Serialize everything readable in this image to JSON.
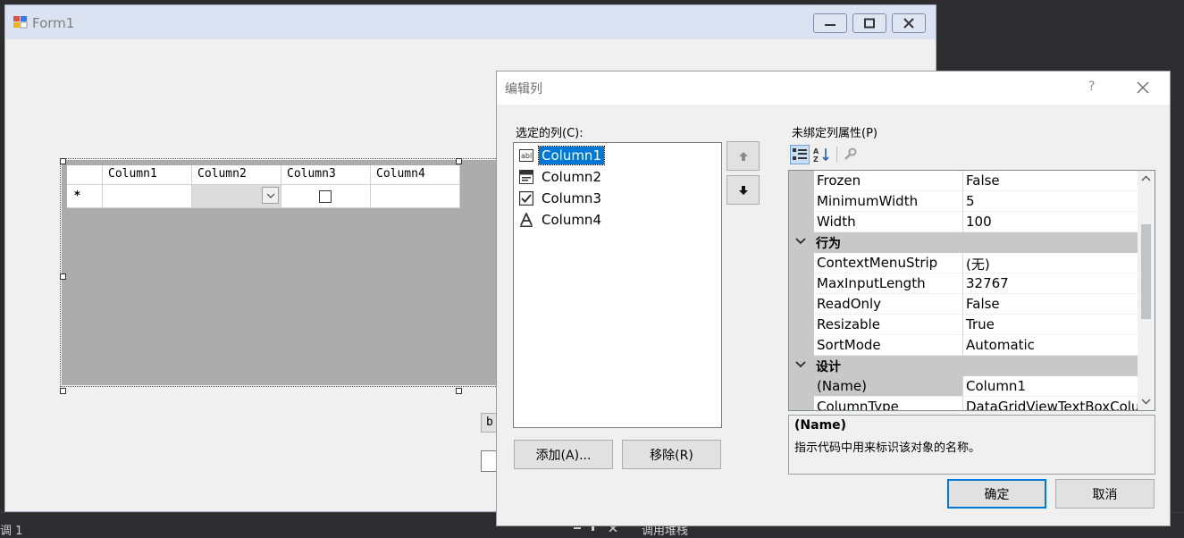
{
  "form1": {
    "title": "Form1",
    "grid": {
      "columns": [
        "Column1",
        "Column2",
        "Column3",
        "Column4"
      ],
      "new_row_marker": "*"
    },
    "partial_button_text": "b"
  },
  "bottom_bar": {
    "left_text": "调 1",
    "right_text": "调用堆栈"
  },
  "dialog": {
    "title": "编辑列",
    "help_glyph": "?",
    "selected_columns_label": "选定的列(C):",
    "columns": [
      {
        "name": "Column1",
        "icon": "textbox-column-icon",
        "selected": true
      },
      {
        "name": "Column2",
        "icon": "combobox-column-icon",
        "selected": false
      },
      {
        "name": "Column3",
        "icon": "checkbox-column-icon",
        "selected": false
      },
      {
        "name": "Column4",
        "icon": "text-a-column-icon",
        "selected": false
      }
    ],
    "add_button": "添加(A)...",
    "remove_button": "移除(R)",
    "properties_label": "未绑定列属性(P)",
    "properties": [
      {
        "kind": "prop",
        "name": "Frozen",
        "value": "False"
      },
      {
        "kind": "prop",
        "name": "MinimumWidth",
        "value": "5"
      },
      {
        "kind": "prop",
        "name": "Width",
        "value": "100"
      },
      {
        "kind": "category",
        "name": "行为"
      },
      {
        "kind": "prop",
        "name": "ContextMenuStrip",
        "value": "(无)"
      },
      {
        "kind": "prop",
        "name": "MaxInputLength",
        "value": "32767"
      },
      {
        "kind": "prop",
        "name": "ReadOnly",
        "value": "False"
      },
      {
        "kind": "prop",
        "name": "Resizable",
        "value": "True"
      },
      {
        "kind": "prop",
        "name": "SortMode",
        "value": "Automatic"
      },
      {
        "kind": "category",
        "name": "设计"
      },
      {
        "kind": "prop",
        "name": "(Name)",
        "value": "Column1",
        "selected": true
      },
      {
        "kind": "prop",
        "name": "ColumnType",
        "value": "DataGridViewTextBoxColu"
      }
    ],
    "description": {
      "title": "(Name)",
      "text": "指示代码中用来标识该对象的名称。"
    },
    "ok_button": "确定",
    "cancel_button": "取消"
  },
  "colors": {
    "selection": "#0078d7",
    "category_bg": "#c8c8c8",
    "grid_background": "#ababab",
    "ide_dark": "#2d2d30"
  }
}
